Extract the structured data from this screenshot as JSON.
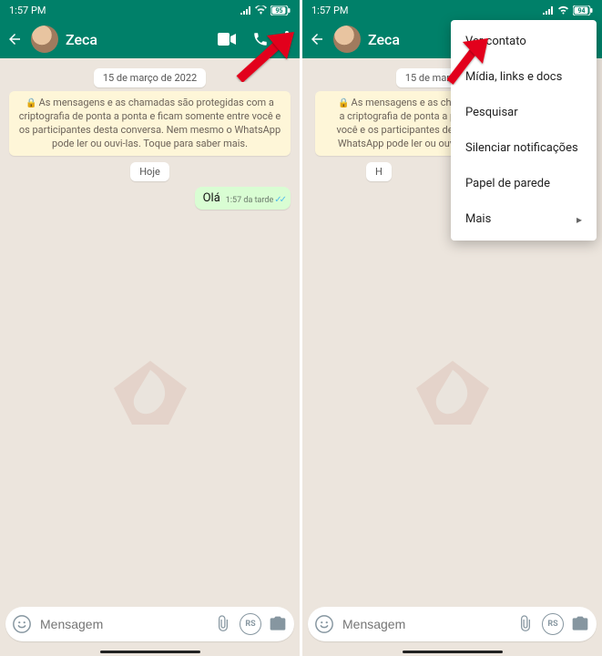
{
  "status": {
    "time": "1:57 PM",
    "battery": "95"
  },
  "contact": {
    "name": "Zeca"
  },
  "chips": {
    "date": "15 de março de 2022",
    "today": "Hoje"
  },
  "encryption": "As mensagens e as chamadas são protegidas com a criptografia de ponta a ponta e ficam somente entre você e os participantes desta conversa. Nem mesmo o WhatsApp pode ler ou ouvi-las. Toque para saber mais.",
  "message": {
    "text": "Olá",
    "time": "1:57 da tarde"
  },
  "input": {
    "placeholder": "Mensagem",
    "rs": "RS"
  },
  "menu": {
    "view": "Ver contato",
    "media": "Mídia, links e docs",
    "search": "Pesquisar",
    "mute": "Silenciar notificações",
    "wallpaper": "Papel de parede",
    "more": "Mais"
  }
}
